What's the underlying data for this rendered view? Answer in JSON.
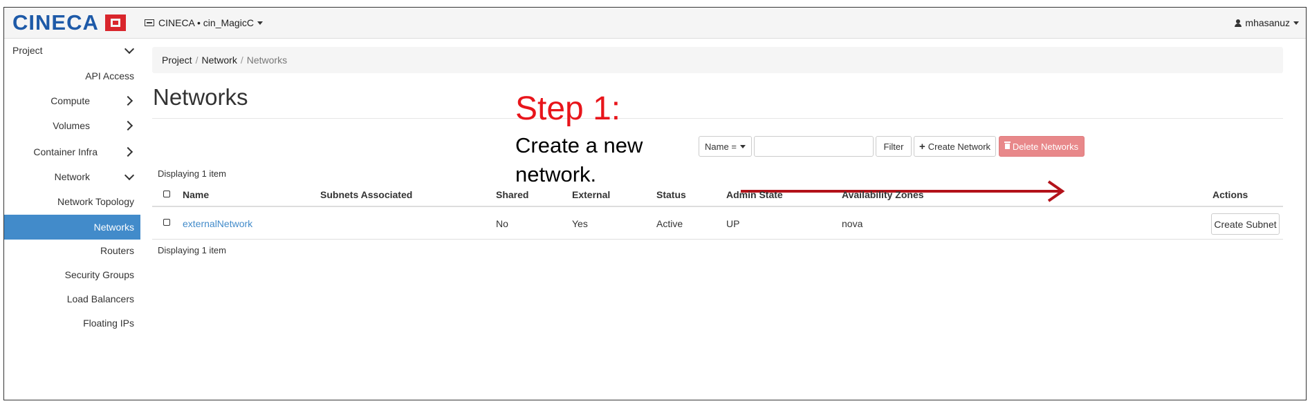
{
  "header": {
    "brand": "CINECA",
    "project_selector": "CINECA • cin_MagicC",
    "user": "mhasanuz"
  },
  "sidebar": {
    "project_label": "Project",
    "api_access": "API Access",
    "compute": "Compute",
    "volumes": "Volumes",
    "container_infra": "Container Infra",
    "network": "Network",
    "network_items": [
      "Network Topology",
      "Networks",
      "Routers",
      "Security Groups",
      "Load Balancers",
      "Floating IPs"
    ],
    "active_item": "Networks"
  },
  "breadcrumb": [
    "Project",
    "Network",
    "Networks"
  ],
  "page_title": "Networks",
  "annotation": {
    "step": "Step 1:",
    "text": "Create a new network."
  },
  "toolbar": {
    "filter_field": "Name =",
    "filter_value": "",
    "filter_button": "Filter",
    "create_button": "Create Network",
    "delete_button": "Delete Networks"
  },
  "table": {
    "display_count": "Displaying 1 item",
    "columns": [
      "Name",
      "Subnets Associated",
      "Shared",
      "External",
      "Status",
      "Admin State",
      "Availability Zones",
      "Actions"
    ],
    "rows": [
      {
        "name": "externalNetwork",
        "subnets": "",
        "shared": "No",
        "external": "Yes",
        "status": "Active",
        "admin_state": "UP",
        "zones": "nova",
        "action": "Create Subnet"
      }
    ]
  },
  "colors": {
    "brand_blue": "#1e5aa8",
    "brand_red": "#d9262c",
    "active_nav": "#428bca",
    "annotation_red": "#e8151b",
    "arrow": "#b3121a",
    "danger_button": "#e8888a"
  }
}
